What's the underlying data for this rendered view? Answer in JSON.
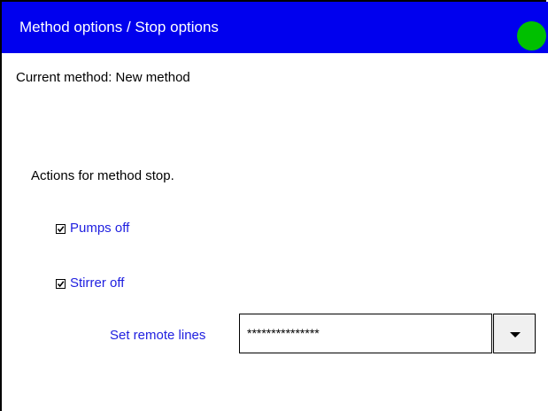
{
  "header": {
    "title": "Method options / Stop options",
    "status_color": "#00c000",
    "accent_color": "#0000ee"
  },
  "current_method": "Current method: New method",
  "section_label": "Actions for method stop.",
  "options": [
    {
      "label": "Pumps off",
      "checked": true
    },
    {
      "label": "Stirrer off",
      "checked": true
    }
  ],
  "remote_lines": {
    "label": "Set remote lines",
    "value": "***************",
    "dropdown_icon": "chevron-down-icon"
  }
}
